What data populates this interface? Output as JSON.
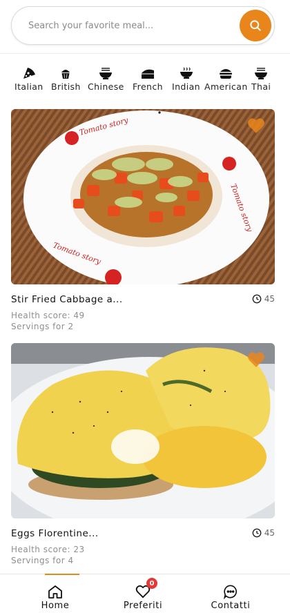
{
  "search": {
    "placeholder": "Search your favorite meal..."
  },
  "categories": [
    {
      "label": "Italian",
      "icon": "pizza-icon"
    },
    {
      "label": "British",
      "icon": "cupcake-icon"
    },
    {
      "label": "Chinese",
      "icon": "noodle-bowl-icon"
    },
    {
      "label": "French",
      "icon": "cheese-icon"
    },
    {
      "label": "Indian",
      "icon": "curry-bowl-icon"
    },
    {
      "label": "American",
      "icon": "burger-icon"
    },
    {
      "label": "Thai",
      "icon": "soup-bowl-icon"
    }
  ],
  "recipes": [
    {
      "title": "Stir Fried Cabbage a...",
      "minutes": "45",
      "health": "Health score: 49",
      "servings": "Servings for 2",
      "favorite": true
    },
    {
      "title": "Eggs Florentine...",
      "minutes": "45",
      "health": "Health score: 23",
      "servings": "Servings for 4",
      "favorite": true
    }
  ],
  "nav": [
    {
      "label": "Home",
      "icon": "home-icon",
      "active": true
    },
    {
      "label": "Preferiti",
      "icon": "heart-icon",
      "badge": "0"
    },
    {
      "label": "Contatti",
      "icon": "chat-icon"
    }
  ],
  "colors": {
    "accent": "#e8861b",
    "badge": "#e53935"
  }
}
